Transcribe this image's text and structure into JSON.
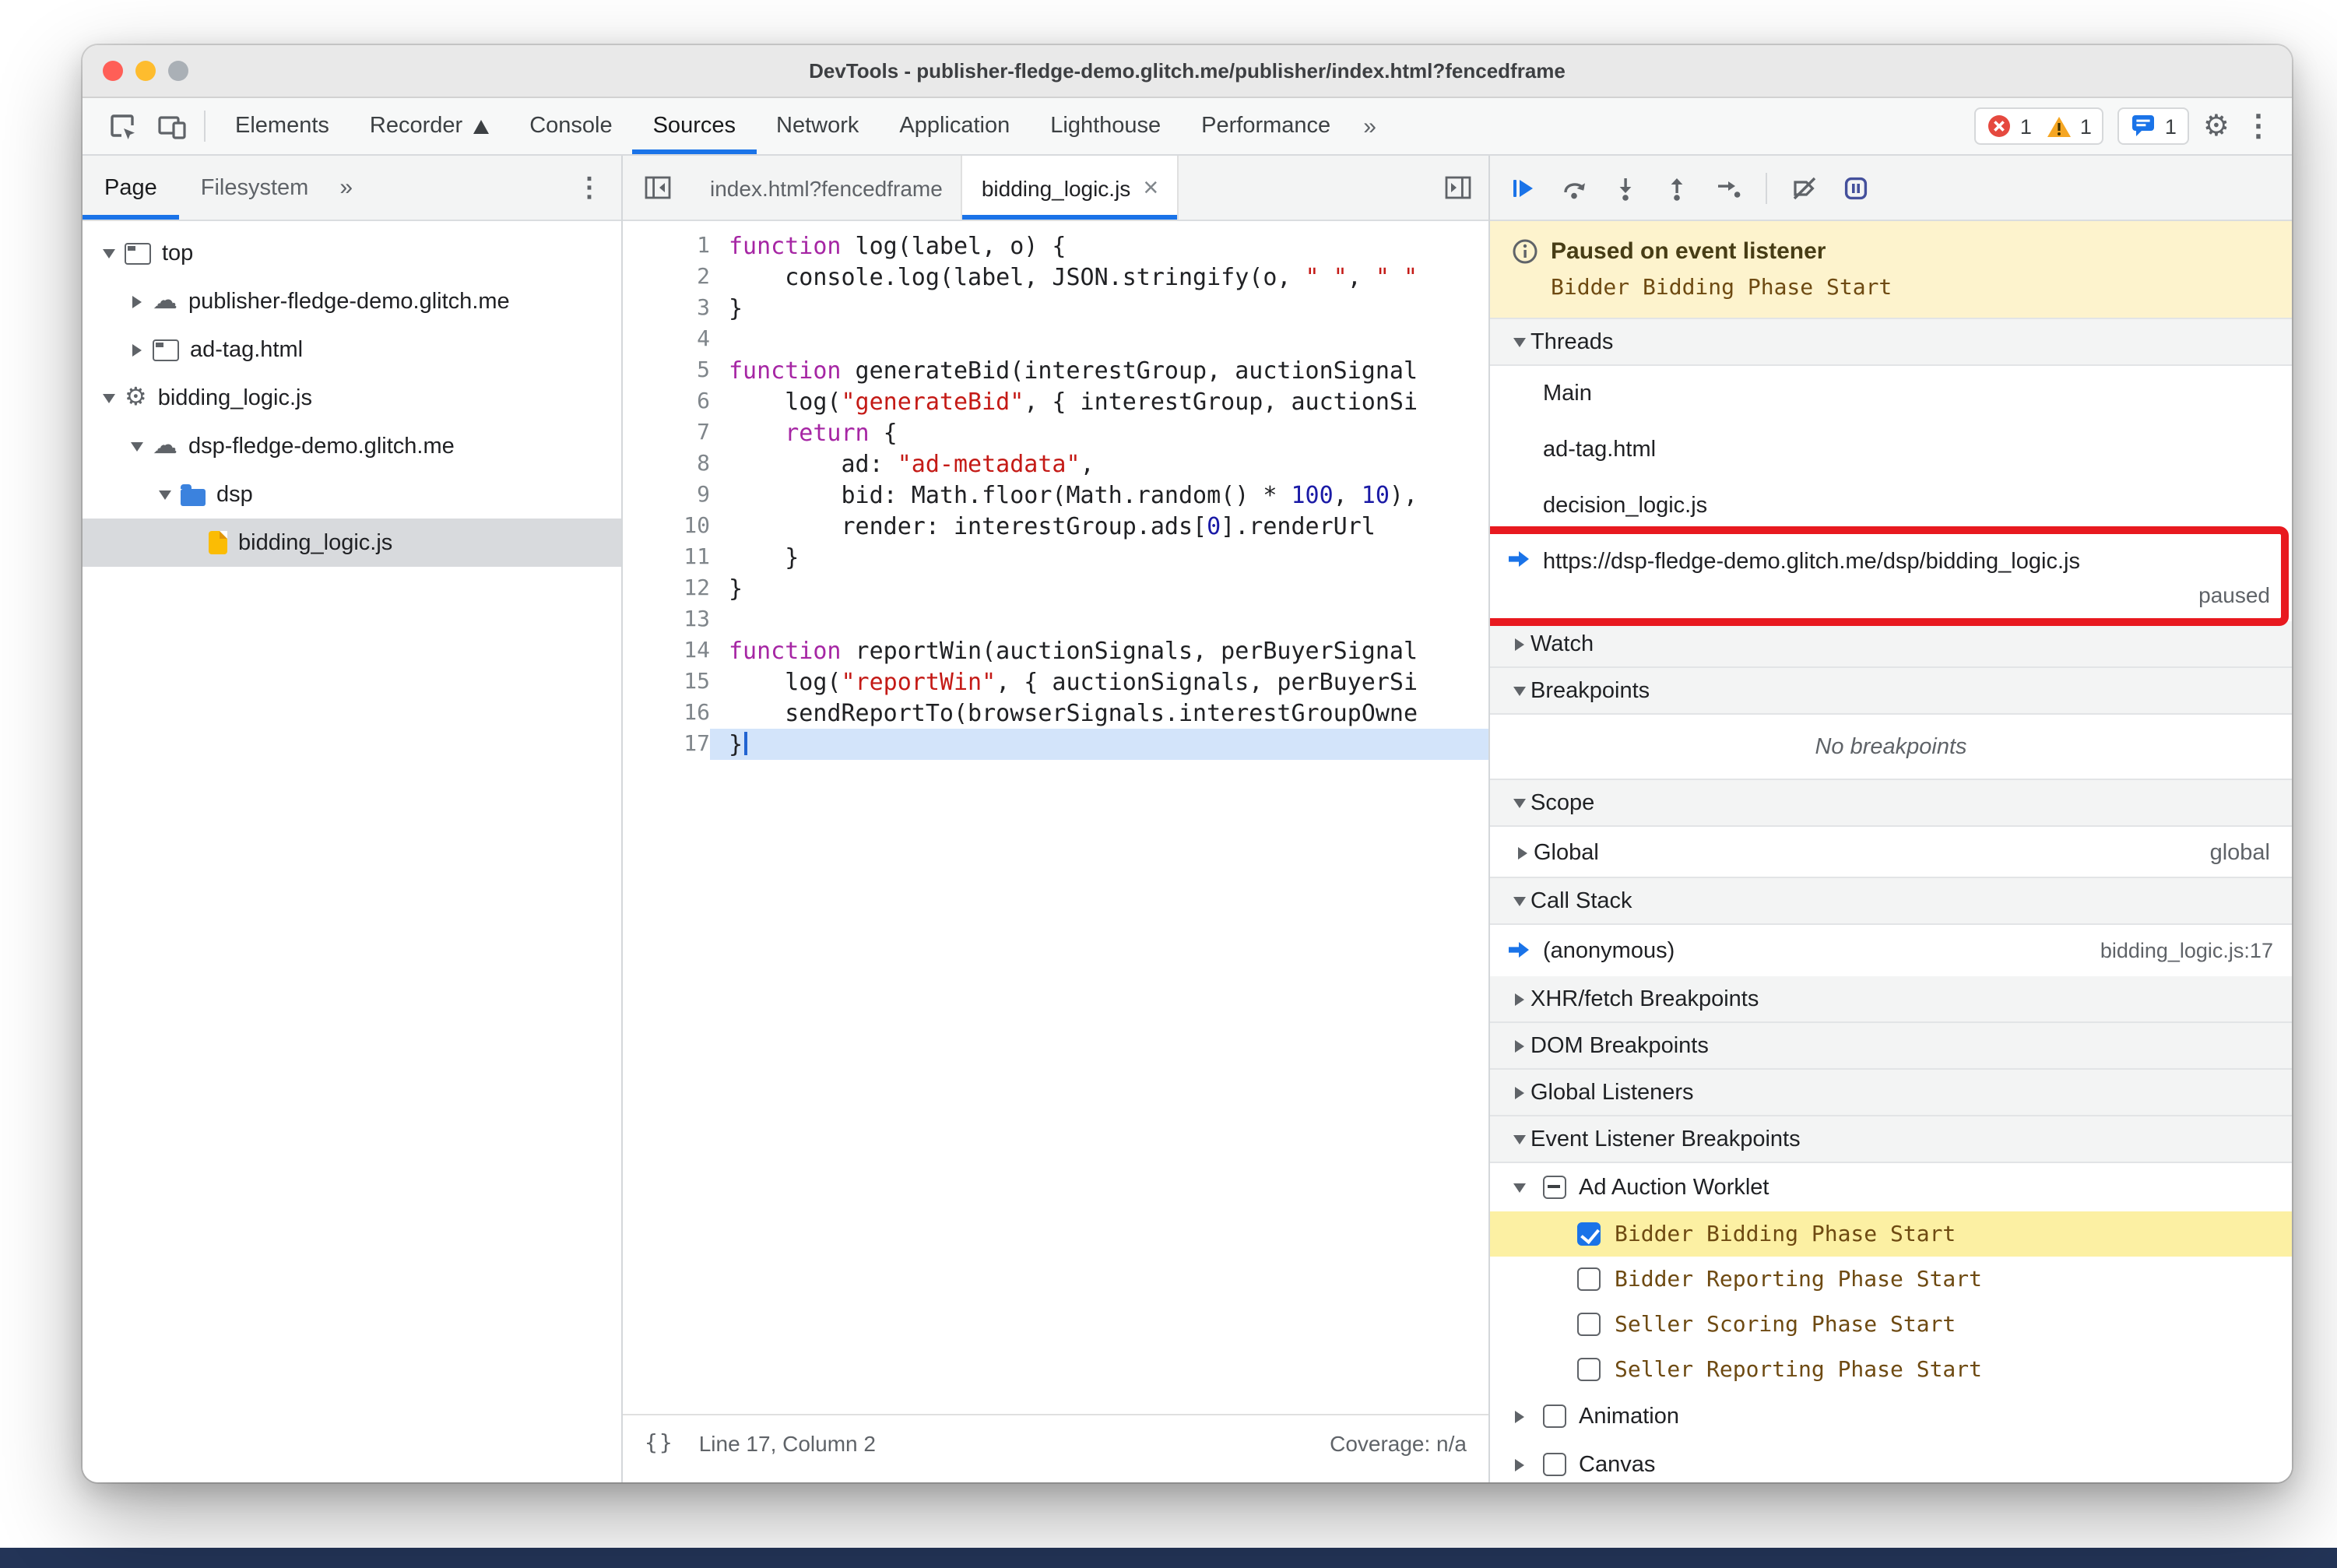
{
  "colors": {
    "accent_blue": "#1a73e8",
    "annotation_red": "#e8191f",
    "paused_banner_bg": "#fdf3cd",
    "breakpoint_highlight": "#fcf0a3"
  },
  "window": {
    "title": "DevTools - publisher-fledge-demo.glitch.me/publisher/index.html?fencedframe"
  },
  "main_toolbar": {
    "tabs": [
      {
        "label": "Elements",
        "active": false,
        "experiment": false
      },
      {
        "label": "Recorder",
        "active": false,
        "experiment": true
      },
      {
        "label": "Console",
        "active": false,
        "experiment": false
      },
      {
        "label": "Sources",
        "active": true,
        "experiment": false
      },
      {
        "label": "Network",
        "active": false,
        "experiment": false
      },
      {
        "label": "Application",
        "active": false,
        "experiment": false
      },
      {
        "label": "Lighthouse",
        "active": false,
        "experiment": false
      },
      {
        "label": "Performance",
        "active": false,
        "experiment": false
      }
    ],
    "more_tabs_label": "»",
    "error_count": "1",
    "warning_count": "1",
    "issues_count": "1",
    "kebab_glyph": "⋮",
    "gear_glyph": "⚙"
  },
  "navigator": {
    "tabs": [
      {
        "label": "Page",
        "active": true
      },
      {
        "label": "Filesystem",
        "active": false
      }
    ],
    "more_label": "»",
    "kebab_glyph": "⋮",
    "tree": [
      {
        "label": "top",
        "depth": 0,
        "arrow": "down",
        "icon": "frame",
        "selected": false
      },
      {
        "label": "publisher-fledge-demo.glitch.me",
        "depth": 1,
        "arrow": "right",
        "icon": "cloud",
        "selected": false
      },
      {
        "label": "ad-tag.html",
        "depth": 1,
        "arrow": "right",
        "icon": "frame",
        "selected": false
      },
      {
        "label": "bidding_logic.js",
        "depth": 0,
        "arrow": "down",
        "icon": "gear",
        "selected": false
      },
      {
        "label": "dsp-fledge-demo.glitch.me",
        "depth": 1,
        "arrow": "down",
        "icon": "cloud",
        "selected": false
      },
      {
        "label": "dsp",
        "depth": 2,
        "arrow": "down",
        "icon": "folder",
        "selected": false
      },
      {
        "label": "bidding_logic.js",
        "depth": 3,
        "arrow": "none",
        "icon": "file",
        "selected": true
      }
    ]
  },
  "editor": {
    "tabs": [
      {
        "label": "index.html?fencedframe",
        "active": false,
        "closable": false
      },
      {
        "label": "bidding_logic.js",
        "active": true,
        "closable": true
      }
    ],
    "close_glyph": "×",
    "current_line": 17,
    "lines": [
      {
        "n": 1,
        "tk": [
          [
            "k",
            "function"
          ],
          [
            "p",
            " log(label, o) {"
          ]
        ]
      },
      {
        "n": 2,
        "tk": [
          [
            "p",
            "    console.log(label, JSON.stringify(o, "
          ],
          [
            "s",
            "\" \""
          ],
          [
            "p",
            ", "
          ],
          [
            "s",
            "\" \""
          ]
        ]
      },
      {
        "n": 3,
        "tk": [
          [
            "p",
            "}"
          ]
        ]
      },
      {
        "n": 4,
        "tk": []
      },
      {
        "n": 5,
        "tk": [
          [
            "k",
            "function"
          ],
          [
            "p",
            " generateBid(interestGroup, auctionSignal"
          ]
        ]
      },
      {
        "n": 6,
        "tk": [
          [
            "p",
            "    log("
          ],
          [
            "s",
            "\"generateBid\""
          ],
          [
            "p",
            ", { interestGroup, auctionSi"
          ]
        ]
      },
      {
        "n": 7,
        "tk": [
          [
            "p",
            "    "
          ],
          [
            "k",
            "return"
          ],
          [
            "p",
            " {"
          ]
        ]
      },
      {
        "n": 8,
        "tk": [
          [
            "p",
            "        ad: "
          ],
          [
            "s",
            "\"ad-metadata\""
          ],
          [
            "p",
            ","
          ]
        ]
      },
      {
        "n": 9,
        "tk": [
          [
            "p",
            "        bid: Math.floor(Math.random() * "
          ],
          [
            "n",
            "100"
          ],
          [
            "p",
            ", "
          ],
          [
            "n",
            "10"
          ],
          [
            "p",
            "),"
          ]
        ]
      },
      {
        "n": 10,
        "tk": [
          [
            "p",
            "        render: interestGroup.ads["
          ],
          [
            "n",
            "0"
          ],
          [
            "p",
            "].renderUrl"
          ]
        ]
      },
      {
        "n": 11,
        "tk": [
          [
            "p",
            "    }"
          ]
        ]
      },
      {
        "n": 12,
        "tk": [
          [
            "p",
            "}"
          ]
        ]
      },
      {
        "n": 13,
        "tk": []
      },
      {
        "n": 14,
        "tk": [
          [
            "k",
            "function"
          ],
          [
            "p",
            " reportWin(auctionSignals, perBuyerSignal"
          ]
        ]
      },
      {
        "n": 15,
        "tk": [
          [
            "p",
            "    log("
          ],
          [
            "s",
            "\"reportWin\""
          ],
          [
            "p",
            ", { auctionSignals, perBuyerSi"
          ]
        ]
      },
      {
        "n": 16,
        "tk": [
          [
            "p",
            "    sendReportTo(browserSignals.interestGroupOwne"
          ]
        ]
      },
      {
        "n": 17,
        "tk": [
          [
            "p",
            "}"
          ]
        ]
      }
    ],
    "status": {
      "brackets": "{}",
      "position": "Line 17, Column 2",
      "coverage": "Coverage: n/a"
    }
  },
  "debugger": {
    "banner": {
      "title": "Paused on event listener",
      "detail": "Bidder Bidding Phase Start"
    },
    "threads": {
      "label": "Threads",
      "items": [
        {
          "label": "Main",
          "active": false,
          "status": "",
          "annotated": false
        },
        {
          "label": "ad-tag.html",
          "active": false,
          "status": "",
          "annotated": false
        },
        {
          "label": "decision_logic.js",
          "active": false,
          "status": "",
          "annotated": false
        },
        {
          "label": "https://dsp-fledge-demo.glitch.me/dsp/bidding_logic.js",
          "active": true,
          "status": "paused",
          "annotated": true
        }
      ]
    },
    "watch": {
      "label": "Watch"
    },
    "breakpoints": {
      "label": "Breakpoints",
      "empty_text": "No breakpoints"
    },
    "scope": {
      "label": "Scope",
      "items": [
        {
          "label": "Global",
          "value": "global"
        }
      ]
    },
    "call_stack": {
      "label": "Call Stack",
      "frames": [
        {
          "label": "(anonymous)",
          "location": "bidding_logic.js:17"
        }
      ]
    },
    "xhr_breakpoints": {
      "label": "XHR/fetch Breakpoints"
    },
    "dom_breakpoints": {
      "label": "DOM Breakpoints"
    },
    "global_listeners": {
      "label": "Global Listeners"
    },
    "event_listener_breakpoints": {
      "label": "Event Listener Breakpoints",
      "entries": [
        {
          "type": "category",
          "label": "Ad Auction Worklet",
          "checked": "mixed",
          "expanded": true,
          "highlighted": false
        },
        {
          "type": "leaf",
          "label": "Bidder Bidding Phase Start",
          "checked": "on",
          "highlighted": true
        },
        {
          "type": "leaf",
          "label": "Bidder Reporting Phase Start",
          "checked": "off",
          "highlighted": false
        },
        {
          "type": "leaf",
          "label": "Seller Scoring Phase Start",
          "checked": "off",
          "highlighted": false
        },
        {
          "type": "leaf",
          "label": "Seller Reporting Phase Start",
          "checked": "off",
          "highlighted": false
        },
        {
          "type": "category",
          "label": "Animation",
          "checked": "off",
          "expanded": false,
          "highlighted": false
        },
        {
          "type": "category",
          "label": "Canvas",
          "checked": "off",
          "expanded": false,
          "highlighted": false
        }
      ]
    }
  }
}
